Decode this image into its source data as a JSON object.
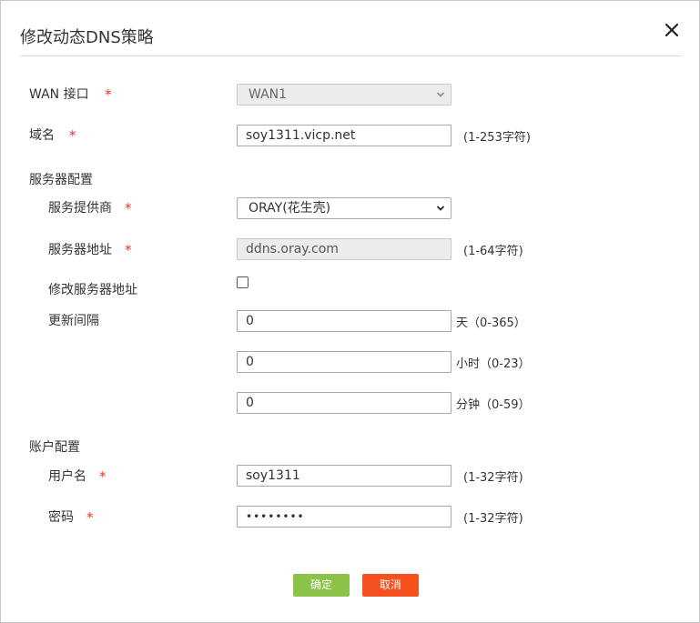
{
  "dialog": {
    "title": "修改动态DNS策略",
    "close_icon": "close-icon"
  },
  "form": {
    "wan": {
      "label": "WAN 接口",
      "required": "*",
      "value": "WAN1",
      "disabled": true
    },
    "domain": {
      "label": "域名",
      "required": "*",
      "value": "soy1311.vicp.net",
      "hint": "(1-253字符)"
    },
    "server_section": "服务器配置",
    "provider": {
      "label": "服务提供商",
      "required": "*",
      "value": "ORAY(花生壳)"
    },
    "server_addr": {
      "label": "服务器地址",
      "required": "*",
      "value": "ddns.oray.com",
      "hint": "(1-64字符)",
      "disabled": true
    },
    "modify_server": {
      "label": "修改服务器地址",
      "checked": false
    },
    "interval": {
      "label": "更新间隔",
      "days": {
        "value": "0",
        "unit": "天（0-365）"
      },
      "hours": {
        "value": "0",
        "unit": "小时（0-23）"
      },
      "minutes": {
        "value": "0",
        "unit": "分钟（0-59）"
      }
    },
    "account_section": "账户配置",
    "username": {
      "label": "用户名",
      "required": "*",
      "value": "soy1311",
      "hint": "(1-32字符)"
    },
    "password": {
      "label": "密码",
      "required": "*",
      "value": "••••••••",
      "hint": "(1-32字符)"
    }
  },
  "buttons": {
    "ok": "确定",
    "cancel": "取消"
  },
  "colors": {
    "required": "#e8352c",
    "ok_button": "#8bc34a",
    "cancel_button": "#f4511e"
  }
}
